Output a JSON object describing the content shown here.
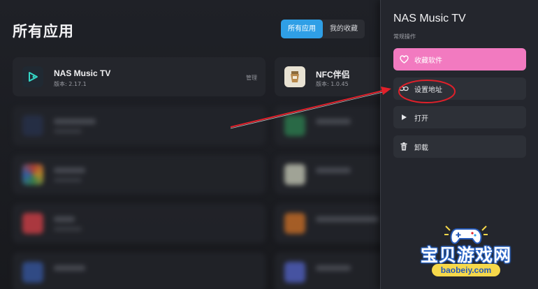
{
  "page": {
    "title": "所有应用"
  },
  "tabs": [
    {
      "label": "所有应用",
      "active": true
    },
    {
      "label": "我的收藏",
      "active": false
    }
  ],
  "apps": [
    {
      "name": "NAS Music TV",
      "version": "版本: 2.17.1",
      "action": "管理",
      "icon": "nas-music-tv-icon"
    },
    {
      "name": "NFC伴侣",
      "version": "版本: 1.0.45",
      "icon": "nfc-companion-icon"
    }
  ],
  "panel": {
    "title": "NAS Music TV",
    "subtitle": "常规操作",
    "actions": [
      {
        "label": "收藏软件",
        "icon": "heart-icon"
      },
      {
        "label": "设置地址",
        "icon": "link-icon"
      },
      {
        "label": "打开",
        "icon": "play-icon"
      },
      {
        "label": "卸载",
        "icon": "trash-icon"
      }
    ]
  },
  "watermark": {
    "text": "宝贝游戏网",
    "url": "baobeiy.com"
  },
  "colors": {
    "accent_tab": "#2f9fe6",
    "favorite": "#f27ac0",
    "annotation": "#e0202a",
    "watermark_blue": "#2559b8",
    "watermark_yellow": "#f6d84a"
  }
}
